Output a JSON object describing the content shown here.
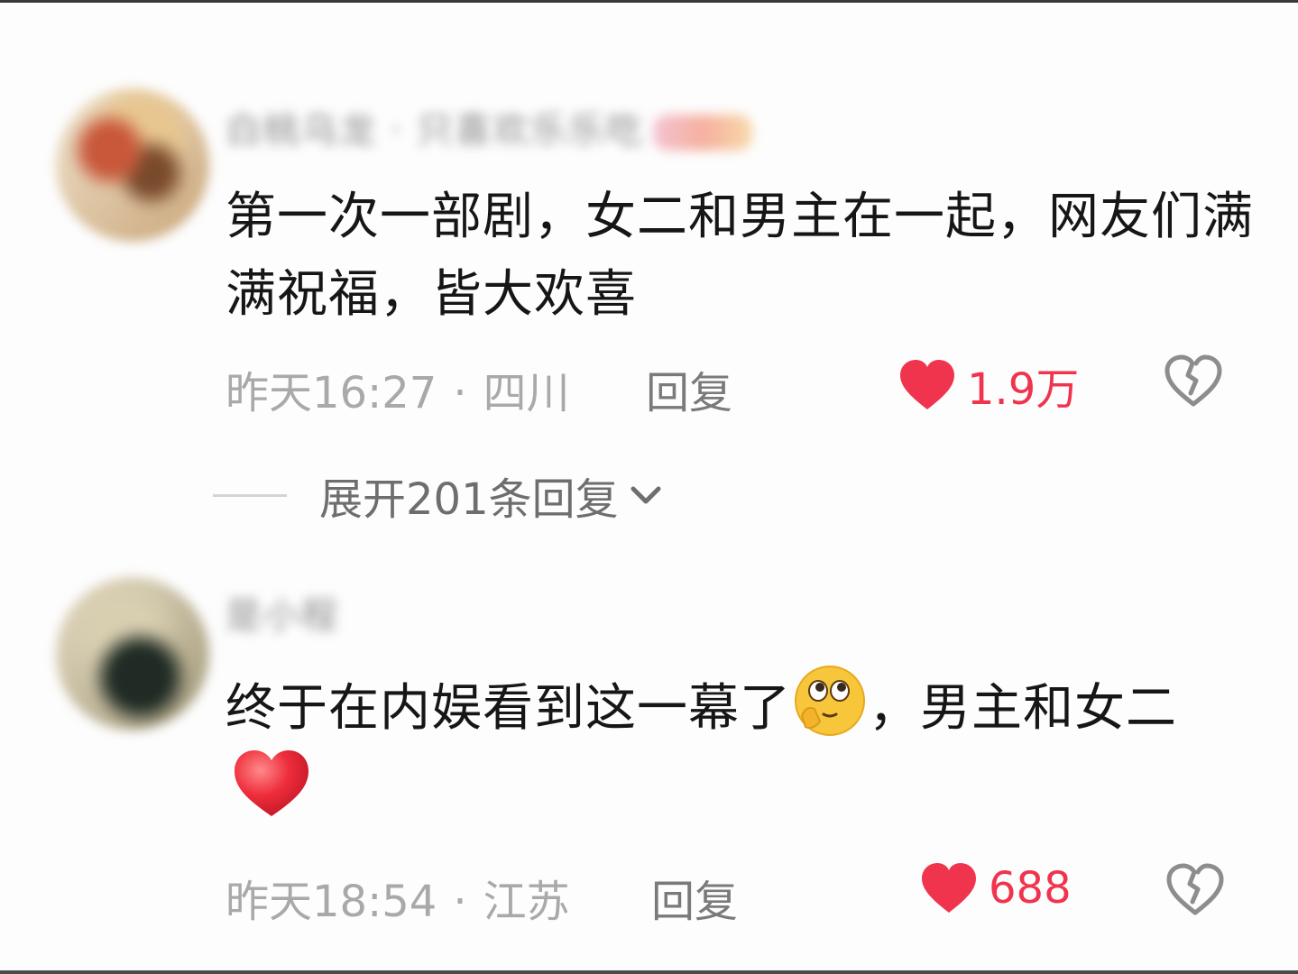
{
  "comments": [
    {
      "username": "白桃乌龙 · 只喜欢乐乐吃",
      "text": "第一次一部剧，女二和男主在一起，网友们满满祝福，皆大欢喜",
      "time": "昨天16:27",
      "separator": "·",
      "location": "四川",
      "reply_label": "回复",
      "likes": "1.9万",
      "expand_label": "展开201条回复"
    },
    {
      "username": "是小程",
      "text_before_emoji": "终于在内娱看到这一幕了",
      "text_after_emoji": "，男主和女二",
      "time": "昨天18:54",
      "separator": "·",
      "location": "江苏",
      "reply_label": "回复",
      "likes": "688"
    }
  ],
  "colors": {
    "like_red": "#f0344e",
    "meta_gray": "#a9a9a9",
    "text": "#161616"
  },
  "icons": {
    "like": "heart-icon",
    "dislike": "broken-heart-icon",
    "expand": "chevron-down-icon",
    "emoji_1": "thinking-face-emoji",
    "emoji_2": "red-heart-emoji"
  }
}
